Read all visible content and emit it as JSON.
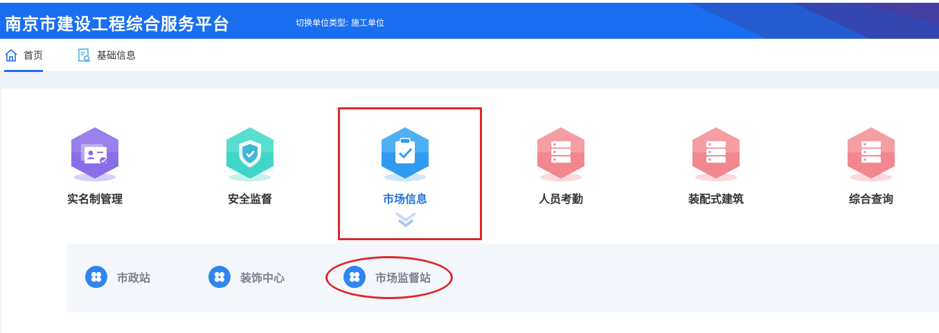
{
  "header": {
    "app_title": "南京市建设工程综合服务平台",
    "switch_label": "切换单位类型:",
    "switch_value": "施工单位"
  },
  "tabs": [
    {
      "label": "首页",
      "icon": "home-icon",
      "active": true
    },
    {
      "label": "基础信息",
      "icon": "document-search-icon",
      "active": false
    }
  ],
  "modules": [
    {
      "label": "实名制管理",
      "icon": "id-card-icon",
      "color": "#8a6ee8"
    },
    {
      "label": "安全监督",
      "icon": "shield-icon",
      "color": "#3fd6c8"
    },
    {
      "label": "市场信息",
      "icon": "clipboard-check-icon",
      "color": "#2f9bf0",
      "active": true
    },
    {
      "label": "人员考勤",
      "icon": "server-stack-icon",
      "color": "#f2888f"
    },
    {
      "label": "装配式建筑",
      "icon": "server-stack-icon",
      "color": "#f2888f"
    },
    {
      "label": "综合查询",
      "icon": "server-stack-icon",
      "color": "#f2888f"
    }
  ],
  "submenu": [
    {
      "label": "市政站",
      "icon": "clover-icon"
    },
    {
      "label": "装饰中心",
      "icon": "clover-icon"
    },
    {
      "label": "市场监督站",
      "icon": "clover-icon"
    }
  ],
  "colors": {
    "header_bg": "#1a6ef0",
    "active_text": "#2273d9",
    "annotation": "#e0242a"
  }
}
